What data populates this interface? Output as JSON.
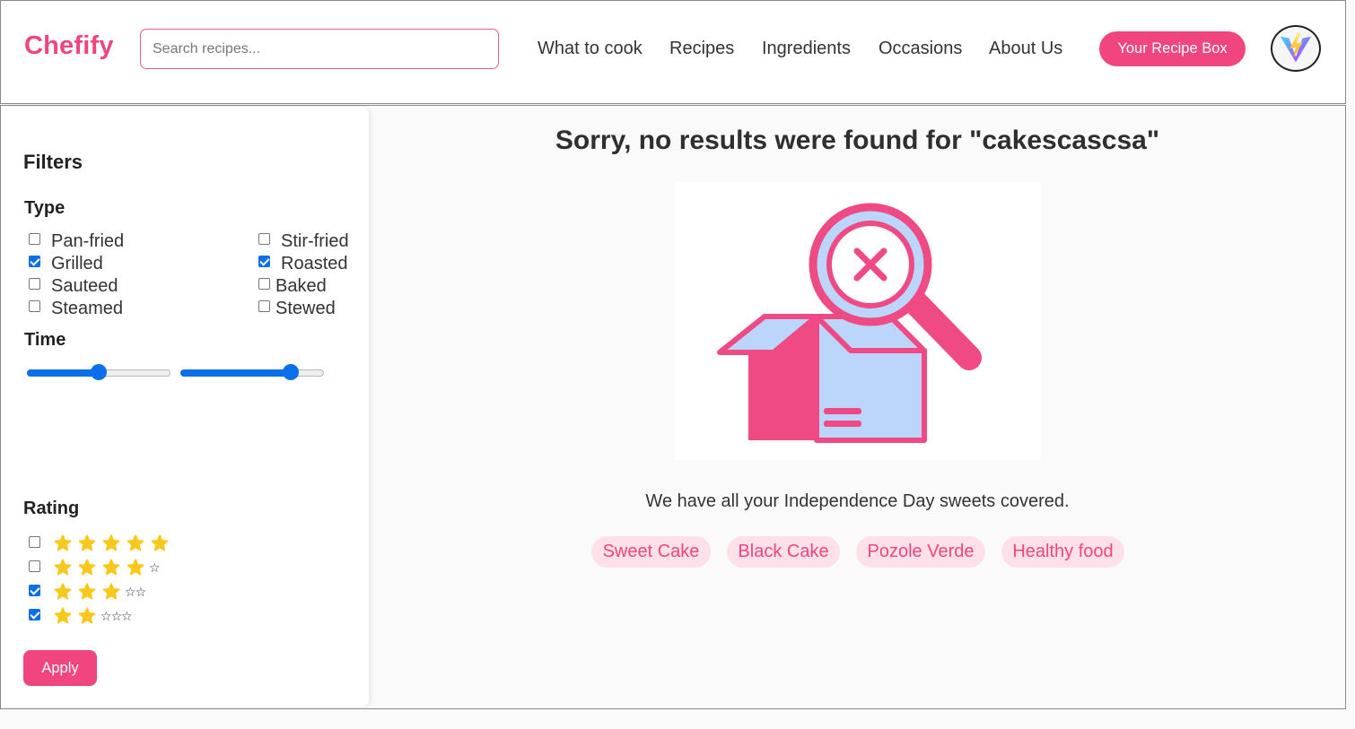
{
  "header": {
    "logo": "Chefify",
    "search_placeholder": "Search recipes...",
    "nav": [
      "What to cook",
      "Recipes",
      "Ingredients",
      "Occasions",
      "About Us"
    ],
    "recipe_box_label": "Your Recipe Box",
    "avatar_icon": "vite-logo-icon"
  },
  "filters": {
    "title": "Filters",
    "type_title": "Type",
    "types": [
      {
        "label": "Pan-fried",
        "checked": false
      },
      {
        "label": "Stir-fried",
        "checked": false
      },
      {
        "label": "Grilled",
        "checked": true
      },
      {
        "label": "Roasted",
        "checked": true
      },
      {
        "label": "Sauteed",
        "checked": false
      },
      {
        "label": "Baked",
        "checked": false
      },
      {
        "label": "Steamed",
        "checked": false
      },
      {
        "label": "Stewed",
        "checked": false
      }
    ],
    "time_title": "Time",
    "time_sliders": [
      {
        "value_fraction": 0.5
      },
      {
        "value_fraction": 0.8
      }
    ],
    "rating_title": "Rating",
    "ratings": [
      {
        "stars": 5,
        "checked": false
      },
      {
        "stars": 4,
        "checked": false
      },
      {
        "stars": 3,
        "checked": true
      },
      {
        "stars": 2,
        "checked": true
      }
    ],
    "apply_label": "Apply"
  },
  "results": {
    "message": "Sorry, no results were found for \"cakescascsa\"",
    "tagline": "We have all your Independence Day sweets covered.",
    "suggestions": [
      "Sweet Cake",
      "Black Cake",
      "Pozole Verde",
      "Healthy food"
    ]
  },
  "colors": {
    "brand": "#f0457f",
    "chip_bg": "#fde0e8",
    "checkbox": "#0a6fe8",
    "star": "#f7c91c",
    "illustration_light": "#bcd6fb"
  }
}
